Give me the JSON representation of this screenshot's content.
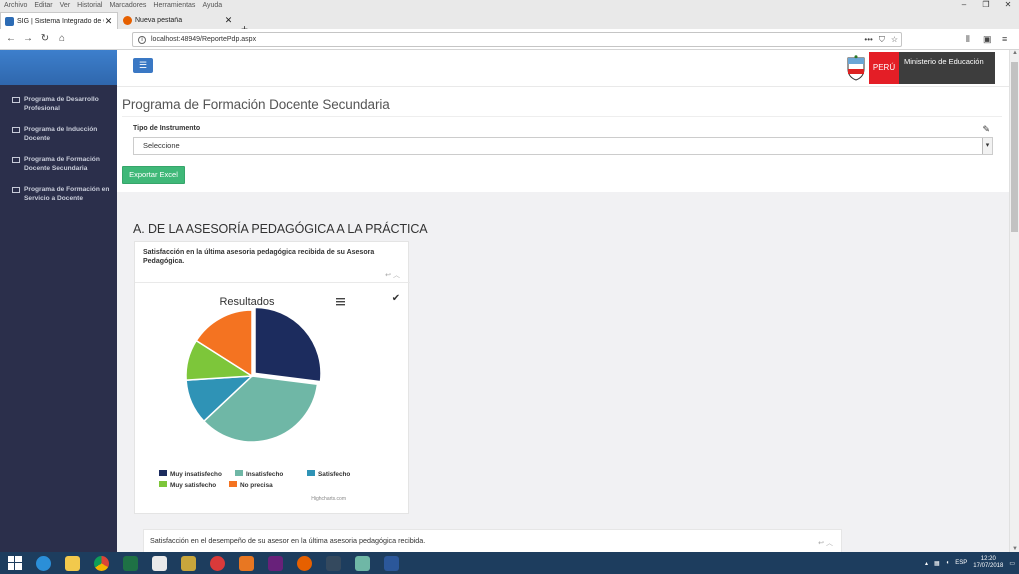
{
  "browser": {
    "menu": [
      "Archivo",
      "Editar",
      "Ver",
      "Historial",
      "Marcadores",
      "Herramientas",
      "Ayuda"
    ],
    "tabs": [
      {
        "title": "SIG | Sistema Integrado de Ges",
        "active": true
      },
      {
        "title": "Nueva pestaña",
        "active": false
      }
    ],
    "url": "localhost:48949/ReportePdp.aspx"
  },
  "sidebar": {
    "items": [
      {
        "label": "Programa de Desarrollo Profesional"
      },
      {
        "label": "Programa de Inducción Docente"
      },
      {
        "label": "Programa de Formación Docente Secundaria"
      },
      {
        "label": "Programa de Formación en Servicio a Docente"
      }
    ]
  },
  "header": {
    "brand_country": "PERÚ",
    "brand_ministry": "Ministerio de Educación",
    "menu_icon": "hamburger-icon"
  },
  "page": {
    "title": "Programa de Formación Docente Secundaria",
    "instrument_label": "Tipo de Instrumento",
    "instrument_value": "Seleccione",
    "export_button": "Exportar Excel",
    "section_title": "A. DE LA ASESORÍA PEDAGÓGICA A LA PRÁCTICA",
    "card1_title": "Satisfacción en la última asesoria pedagógica recibida de su Asesora Pedagógica.",
    "card2_title": "Satisfacción en el desempeño de su asesor en la última asesoria pedagógica recibida."
  },
  "chart_data": {
    "type": "pie",
    "title": "Resultados",
    "credits": "Highcharts.com",
    "series": [
      {
        "name": "Muy insatisfecho",
        "value": 27,
        "color": "#1c2c5e"
      },
      {
        "name": "Insatisfecho",
        "value": 36,
        "color": "#6fb7a6"
      },
      {
        "name": "Satisfecho",
        "value": 11,
        "color": "#2f93b6"
      },
      {
        "name": "Muy satisfecho",
        "value": 10,
        "color": "#7dc63a"
      },
      {
        "name": "No precisa",
        "value": 16,
        "color": "#f47321"
      }
    ]
  },
  "taskbar": {
    "lang": "ESP",
    "time": "12:20",
    "date": "17/07/2018"
  }
}
